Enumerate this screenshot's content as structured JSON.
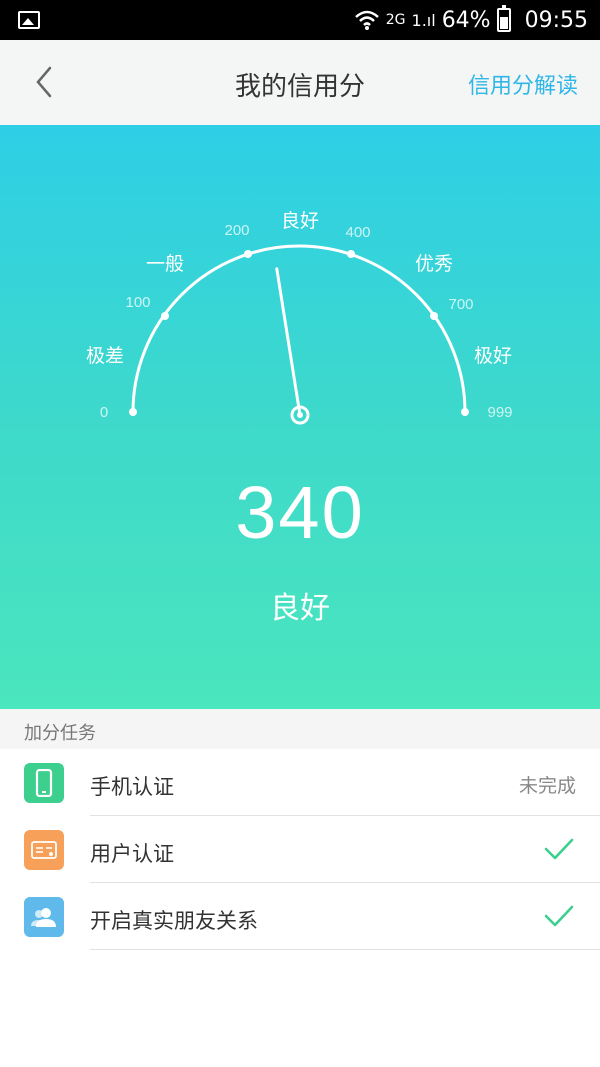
{
  "status_bar": {
    "icons": [
      "image-icon",
      "wifi-icon",
      "2g-icon",
      "signal-icon",
      "battery-icon"
    ],
    "network": "2G",
    "signal": "1.ıl",
    "battery": "64%",
    "time": "09:55"
  },
  "nav": {
    "title": "我的信用分",
    "action": "信用分解读"
  },
  "gauge": {
    "min_label": "0",
    "max_label": "999",
    "ticks": [
      "100",
      "200",
      "400",
      "700"
    ],
    "levels": [
      "极差",
      "一般",
      "良好",
      "优秀",
      "极好"
    ],
    "needle_fraction": 0.45
  },
  "score": {
    "value": "340",
    "level": "良好"
  },
  "tasks": {
    "section_title": "加分任务",
    "items": [
      {
        "label": "手机认证",
        "status": "未完成",
        "done": false,
        "icon": "phone-icon",
        "color": "#3ccf8e"
      },
      {
        "label": "用户认证",
        "status": "",
        "done": true,
        "icon": "id-card-icon",
        "color": "#f7a05a"
      },
      {
        "label": "开启真实朋友关系",
        "status": "",
        "done": true,
        "icon": "friends-icon",
        "color": "#5fb9ea"
      }
    ]
  },
  "colors": {
    "accent": "#2fb7e8",
    "check": "#3ccf8e",
    "gradient_top": "#2ecfe6",
    "gradient_bottom": "#4ae6be"
  }
}
